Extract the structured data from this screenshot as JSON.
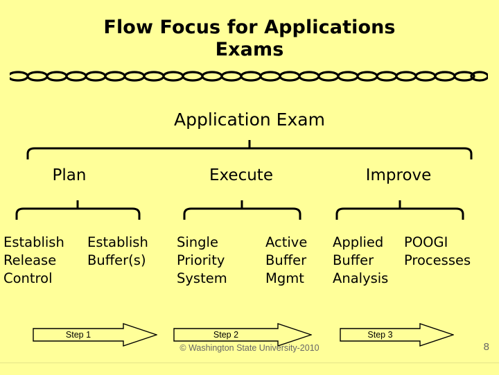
{
  "slide": {
    "title_line1": "Flow Focus for Applications",
    "title_line2": "Exams",
    "top_node": "Application Exam",
    "level2": [
      {
        "label": "Plan"
      },
      {
        "label": "Execute"
      },
      {
        "label": "Improve"
      }
    ],
    "leaves": [
      {
        "label": "Establish\nRelease\nControl"
      },
      {
        "label": "Establish\nBuffer(s)"
      },
      {
        "label": "Single\nPriority\nSystem"
      },
      {
        "label": "Active\nBuffer\nMgmt"
      },
      {
        "label": "Applied\nBuffer\nAnalysis"
      },
      {
        "label": "POOGI\nProcesses"
      }
    ],
    "steps": [
      {
        "label": "Step 1"
      },
      {
        "label": "Step 2"
      },
      {
        "label": "Step 3"
      }
    ],
    "copyright": "© Washington State University-2010",
    "page_number": "8",
    "colors": {
      "background": "#ffff99",
      "text": "#000000",
      "footer_text": "#666666",
      "line": "#000000"
    }
  }
}
